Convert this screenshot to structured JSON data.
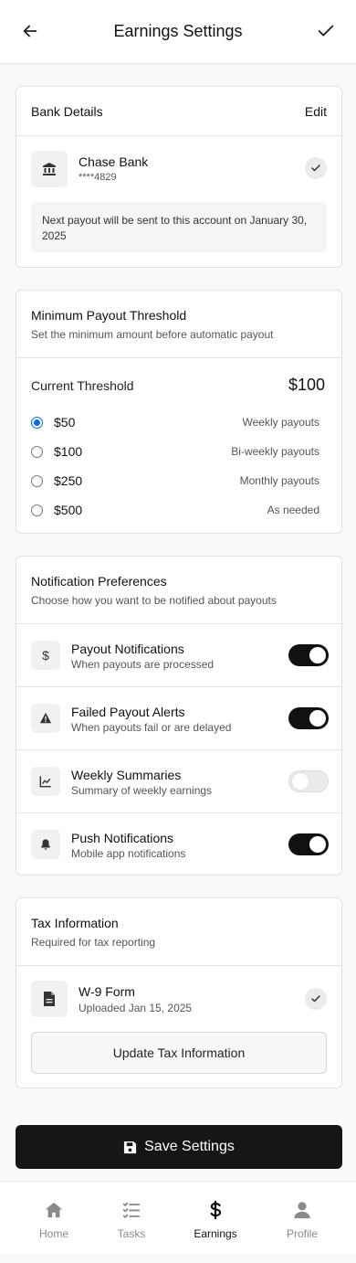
{
  "header": {
    "title": "Earnings Settings"
  },
  "bank": {
    "title": "Bank Details",
    "edit_label": "Edit",
    "bank_name": "Chase Bank",
    "account_masked": "****4829",
    "note": "Next payout will be sent to this account on January 30, 2025"
  },
  "threshold": {
    "title": "Minimum Payout Threshold",
    "subtitle": "Set the minimum amount before automatic payout",
    "current_label": "Current Threshold",
    "current_value": "$100",
    "options": [
      {
        "amount": "$50",
        "desc": "Weekly payouts",
        "selected": true
      },
      {
        "amount": "$100",
        "desc": "Bi-weekly payouts",
        "selected": false
      },
      {
        "amount": "$250",
        "desc": "Monthly payouts",
        "selected": false
      },
      {
        "amount": "$500",
        "desc": "As needed",
        "selected": false
      }
    ]
  },
  "notifications": {
    "title": "Notification Preferences",
    "subtitle": "Choose how you want to be notified about payouts",
    "items": [
      {
        "icon": "dollar-icon",
        "title": "Payout Notifications",
        "desc": "When payouts are processed",
        "enabled": true
      },
      {
        "icon": "warning-icon",
        "title": "Failed Payout Alerts",
        "desc": "When payouts fail or are delayed",
        "enabled": true
      },
      {
        "icon": "chart-line-icon",
        "title": "Weekly Summaries",
        "desc": "Summary of weekly earnings",
        "enabled": false
      },
      {
        "icon": "bell-icon",
        "title": "Push Notifications",
        "desc": "Mobile app notifications",
        "enabled": true
      }
    ]
  },
  "tax": {
    "title": "Tax Information",
    "subtitle": "Required for tax reporting",
    "form_name": "W-9 Form",
    "form_status": "Uploaded Jan 15, 2025",
    "update_label": "Update Tax Information"
  },
  "save_label": "Save Settings",
  "tabs": [
    {
      "label": "Home",
      "icon": "home-icon",
      "active": false
    },
    {
      "label": "Tasks",
      "icon": "tasks-icon",
      "active": false
    },
    {
      "label": "Earnings",
      "icon": "dollar-icon",
      "active": true
    },
    {
      "label": "Profile",
      "icon": "user-icon",
      "active": false
    }
  ],
  "colors": {
    "accent": "#0b6bdc",
    "primary": "#161616",
    "toggle_on": "#111111",
    "toggle_off": "#eaeaea"
  }
}
